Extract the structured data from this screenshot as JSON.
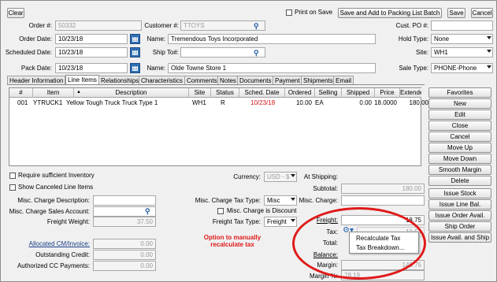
{
  "toolbar": {
    "clear": "Clear",
    "print_on_save": "Print on Save",
    "save_add_packing": "Save and Add to Packing List Batch",
    "save": "Save",
    "cancel": "Cancel"
  },
  "header": {
    "order_no_label": "Order #:",
    "order_no": "50332",
    "customer_label": "Customer #:",
    "customer": "TTOYS",
    "cust_po_label": "Cust. PO #:",
    "cust_po": "",
    "order_date_label": "Order Date:",
    "order_date": "10/23/18",
    "name_label": "Name:",
    "customer_name": "Tremendous Toys Incorporated",
    "hold_type_label": "Hold Type:",
    "hold_type": "None",
    "sched_date_label": "Scheduled Date:",
    "sched_date": "10/23/18",
    "ship_to_label": "Ship To#:",
    "ship_to": "",
    "site_label": "Site:",
    "site": "WH1",
    "pack_date_label": "Pack Date:",
    "pack_date": "10/23/18",
    "ship_name_label": "Name:",
    "ship_name": "Olde Towne Store 1",
    "sale_type_label": "Sale Type:",
    "sale_type": "PHONE-Phone"
  },
  "tabs": [
    "Header Information",
    "Line Items",
    "Relationships",
    "Characteristics",
    "Comments",
    "Notes",
    "Documents",
    "Payment",
    "Shipments",
    "Email"
  ],
  "grid": {
    "columns": [
      "#",
      "Item",
      "Description",
      "Site",
      "Status",
      "Sched. Date",
      "Ordered",
      "Selling",
      "Shipped",
      "Price",
      "Extended"
    ],
    "rows": [
      {
        "num": "001",
        "item": "YTRUCK1",
        "description": "Yellow Tough Truck Truck Type 1",
        "site": "WH1",
        "status": "R",
        "sched_date": "10/23/18",
        "ordered": "10.00",
        "selling": "EA",
        "shipped": "0.00",
        "price": "18.0000",
        "extended": "180.00"
      }
    ]
  },
  "side_buttons": [
    "Favorites",
    "New",
    "Edit",
    "Close",
    "Cancel",
    "Move Up",
    "Move Down",
    "Smooth Margin",
    "Delete",
    "Issue Stock",
    "Issue Line Bal.",
    "Issue Order Avail.",
    "Ship Order",
    "Issue Avail. and Ship"
  ],
  "lower": {
    "require_inventory": "Require sufficient Inventory",
    "show_canceled": "Show Canceled Line Items",
    "currency_label": "Currency:",
    "currency": "USD - $",
    "misc_desc_label": "Misc. Charge Description:",
    "misc_desc": "",
    "misc_tax_type_label": "Misc. Charge Tax Type:",
    "misc_tax_type": "Misc",
    "misc_sales_acct_label": "Misc. Charge Sales Account:",
    "misc_sales_acct": "",
    "misc_discount_label": "Misc. Charge is Discount",
    "freight_weight_label": "Freight Weight:",
    "freight_weight": "37.50",
    "freight_tax_type_label": "Freight Tax Type:",
    "freight_tax_type": "Freight",
    "allocated_cm_label": "Allocated CM/Invoice:",
    "allocated_cm": "0.00",
    "outstanding_credit_label": "Outstanding Credit:",
    "outstanding_credit": "0.00",
    "authorized_cc_label": "Authorized CC Payments:",
    "authorized_cc": "0.00"
  },
  "totals": {
    "at_shipping_label": "At Shipping:",
    "subtotal_label": "Subtotal:",
    "subtotal": "180.00",
    "misc_charge_label": "Misc. Charge:",
    "misc_charge": "",
    "freight_label": "Freight:",
    "freight": "18.75",
    "tax_label": "Tax:",
    "tax": "10.54",
    "total_label": "Total:",
    "balance_label": "Balance:",
    "margin_label": "Margin:",
    "margin": "140.75",
    "margin_pct_label": "Margin %:",
    "margin_pct": "78.19"
  },
  "tax_menu": {
    "recalculate": "Recalculate Tax",
    "breakdown": "Tax Breakdown..."
  },
  "annotation": {
    "line1": "Option to manually",
    "line2": "recalculate tax"
  },
  "colors": {
    "annotation_red": "#e01a1a",
    "sched_date_red": "#d01010"
  }
}
